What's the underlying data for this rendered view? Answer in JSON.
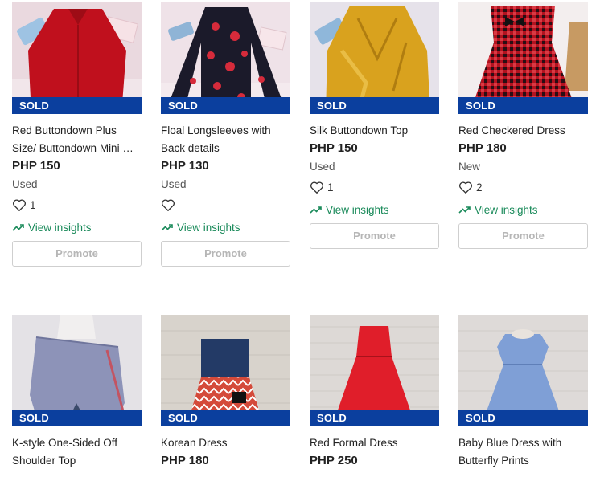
{
  "colors": {
    "sold_badge": "#0b3f9e",
    "insights": "#1a8a5a",
    "promote_text": "#b6b6b6"
  },
  "labels": {
    "sold": "SOLD",
    "view_insights": "View insights",
    "promote": "Promote"
  },
  "items": [
    {
      "title": "Red Buttondown Plus Size/ Buttondown Mini …",
      "price": "PHP 150",
      "condition": "Used",
      "likes": "1",
      "image": "red-buttondown-shirt"
    },
    {
      "title": "Floal Longsleeves with Back details",
      "price": "PHP 130",
      "condition": "Used",
      "likes": "",
      "image": "floral-longsleeves"
    },
    {
      "title": "Silk Buttondown Top",
      "price": "PHP 150",
      "condition": "Used",
      "likes": "1",
      "image": "silk-yellow-top"
    },
    {
      "title": "Red Checkered Dress",
      "price": "PHP 180",
      "condition": "New",
      "likes": "2",
      "image": "red-checkered-dress"
    },
    {
      "title": "K-style One-Sided Off Shoulder Top",
      "image": "kstyle-top"
    },
    {
      "title": "Korean Dress",
      "price": "PHP 180",
      "image": "korean-dress"
    },
    {
      "title": "Red Formal Dress",
      "price": "PHP 250",
      "image": "red-formal-dress"
    },
    {
      "title": "Baby Blue Dress with Butterfly Prints",
      "image": "baby-blue-dress"
    }
  ]
}
